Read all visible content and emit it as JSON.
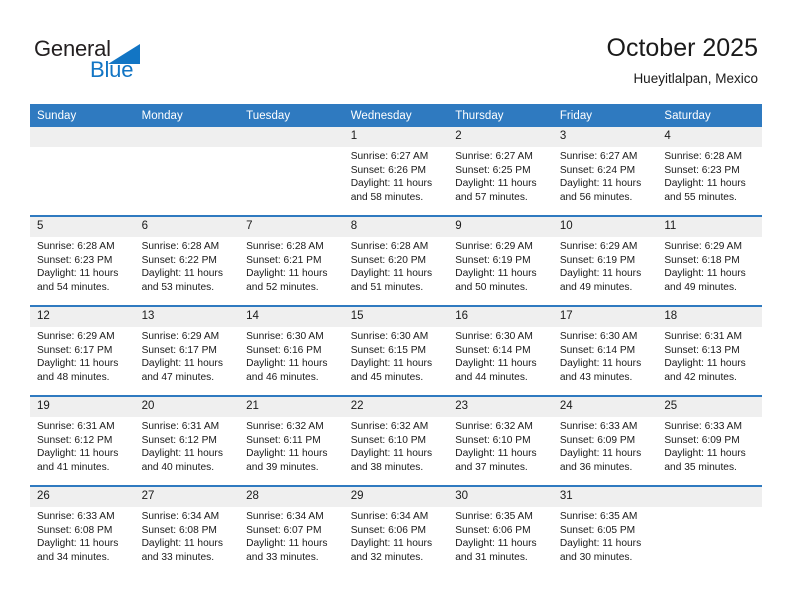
{
  "brand": {
    "name_part1": "General",
    "name_part2": "Blue",
    "accent_color": "#1275c4"
  },
  "header": {
    "title": "October 2025",
    "subtitle": "Hueyitlalpan, Mexico"
  },
  "calendar": {
    "header_color": "#2f7ac0",
    "daynum_band_color": "#efefef",
    "weekday_headers": [
      "Sunday",
      "Monday",
      "Tuesday",
      "Wednesday",
      "Thursday",
      "Friday",
      "Saturday"
    ],
    "weeks": [
      [
        {
          "day": "",
          "sunrise": "",
          "sunset": "",
          "daylight_line1": "",
          "daylight_line2": ""
        },
        {
          "day": "",
          "sunrise": "",
          "sunset": "",
          "daylight_line1": "",
          "daylight_line2": ""
        },
        {
          "day": "",
          "sunrise": "",
          "sunset": "",
          "daylight_line1": "",
          "daylight_line2": ""
        },
        {
          "day": "1",
          "sunrise": "Sunrise: 6:27 AM",
          "sunset": "Sunset: 6:26 PM",
          "daylight_line1": "Daylight: 11 hours",
          "daylight_line2": "and 58 minutes."
        },
        {
          "day": "2",
          "sunrise": "Sunrise: 6:27 AM",
          "sunset": "Sunset: 6:25 PM",
          "daylight_line1": "Daylight: 11 hours",
          "daylight_line2": "and 57 minutes."
        },
        {
          "day": "3",
          "sunrise": "Sunrise: 6:27 AM",
          "sunset": "Sunset: 6:24 PM",
          "daylight_line1": "Daylight: 11 hours",
          "daylight_line2": "and 56 minutes."
        },
        {
          "day": "4",
          "sunrise": "Sunrise: 6:28 AM",
          "sunset": "Sunset: 6:23 PM",
          "daylight_line1": "Daylight: 11 hours",
          "daylight_line2": "and 55 minutes."
        }
      ],
      [
        {
          "day": "5",
          "sunrise": "Sunrise: 6:28 AM",
          "sunset": "Sunset: 6:23 PM",
          "daylight_line1": "Daylight: 11 hours",
          "daylight_line2": "and 54 minutes."
        },
        {
          "day": "6",
          "sunrise": "Sunrise: 6:28 AM",
          "sunset": "Sunset: 6:22 PM",
          "daylight_line1": "Daylight: 11 hours",
          "daylight_line2": "and 53 minutes."
        },
        {
          "day": "7",
          "sunrise": "Sunrise: 6:28 AM",
          "sunset": "Sunset: 6:21 PM",
          "daylight_line1": "Daylight: 11 hours",
          "daylight_line2": "and 52 minutes."
        },
        {
          "day": "8",
          "sunrise": "Sunrise: 6:28 AM",
          "sunset": "Sunset: 6:20 PM",
          "daylight_line1": "Daylight: 11 hours",
          "daylight_line2": "and 51 minutes."
        },
        {
          "day": "9",
          "sunrise": "Sunrise: 6:29 AM",
          "sunset": "Sunset: 6:19 PM",
          "daylight_line1": "Daylight: 11 hours",
          "daylight_line2": "and 50 minutes."
        },
        {
          "day": "10",
          "sunrise": "Sunrise: 6:29 AM",
          "sunset": "Sunset: 6:19 PM",
          "daylight_line1": "Daylight: 11 hours",
          "daylight_line2": "and 49 minutes."
        },
        {
          "day": "11",
          "sunrise": "Sunrise: 6:29 AM",
          "sunset": "Sunset: 6:18 PM",
          "daylight_line1": "Daylight: 11 hours",
          "daylight_line2": "and 49 minutes."
        }
      ],
      [
        {
          "day": "12",
          "sunrise": "Sunrise: 6:29 AM",
          "sunset": "Sunset: 6:17 PM",
          "daylight_line1": "Daylight: 11 hours",
          "daylight_line2": "and 48 minutes."
        },
        {
          "day": "13",
          "sunrise": "Sunrise: 6:29 AM",
          "sunset": "Sunset: 6:17 PM",
          "daylight_line1": "Daylight: 11 hours",
          "daylight_line2": "and 47 minutes."
        },
        {
          "day": "14",
          "sunrise": "Sunrise: 6:30 AM",
          "sunset": "Sunset: 6:16 PM",
          "daylight_line1": "Daylight: 11 hours",
          "daylight_line2": "and 46 minutes."
        },
        {
          "day": "15",
          "sunrise": "Sunrise: 6:30 AM",
          "sunset": "Sunset: 6:15 PM",
          "daylight_line1": "Daylight: 11 hours",
          "daylight_line2": "and 45 minutes."
        },
        {
          "day": "16",
          "sunrise": "Sunrise: 6:30 AM",
          "sunset": "Sunset: 6:14 PM",
          "daylight_line1": "Daylight: 11 hours",
          "daylight_line2": "and 44 minutes."
        },
        {
          "day": "17",
          "sunrise": "Sunrise: 6:30 AM",
          "sunset": "Sunset: 6:14 PM",
          "daylight_line1": "Daylight: 11 hours",
          "daylight_line2": "and 43 minutes."
        },
        {
          "day": "18",
          "sunrise": "Sunrise: 6:31 AM",
          "sunset": "Sunset: 6:13 PM",
          "daylight_line1": "Daylight: 11 hours",
          "daylight_line2": "and 42 minutes."
        }
      ],
      [
        {
          "day": "19",
          "sunrise": "Sunrise: 6:31 AM",
          "sunset": "Sunset: 6:12 PM",
          "daylight_line1": "Daylight: 11 hours",
          "daylight_line2": "and 41 minutes."
        },
        {
          "day": "20",
          "sunrise": "Sunrise: 6:31 AM",
          "sunset": "Sunset: 6:12 PM",
          "daylight_line1": "Daylight: 11 hours",
          "daylight_line2": "and 40 minutes."
        },
        {
          "day": "21",
          "sunrise": "Sunrise: 6:32 AM",
          "sunset": "Sunset: 6:11 PM",
          "daylight_line1": "Daylight: 11 hours",
          "daylight_line2": "and 39 minutes."
        },
        {
          "day": "22",
          "sunrise": "Sunrise: 6:32 AM",
          "sunset": "Sunset: 6:10 PM",
          "daylight_line1": "Daylight: 11 hours",
          "daylight_line2": "and 38 minutes."
        },
        {
          "day": "23",
          "sunrise": "Sunrise: 6:32 AM",
          "sunset": "Sunset: 6:10 PM",
          "daylight_line1": "Daylight: 11 hours",
          "daylight_line2": "and 37 minutes."
        },
        {
          "day": "24",
          "sunrise": "Sunrise: 6:33 AM",
          "sunset": "Sunset: 6:09 PM",
          "daylight_line1": "Daylight: 11 hours",
          "daylight_line2": "and 36 minutes."
        },
        {
          "day": "25",
          "sunrise": "Sunrise: 6:33 AM",
          "sunset": "Sunset: 6:09 PM",
          "daylight_line1": "Daylight: 11 hours",
          "daylight_line2": "and 35 minutes."
        }
      ],
      [
        {
          "day": "26",
          "sunrise": "Sunrise: 6:33 AM",
          "sunset": "Sunset: 6:08 PM",
          "daylight_line1": "Daylight: 11 hours",
          "daylight_line2": "and 34 minutes."
        },
        {
          "day": "27",
          "sunrise": "Sunrise: 6:34 AM",
          "sunset": "Sunset: 6:08 PM",
          "daylight_line1": "Daylight: 11 hours",
          "daylight_line2": "and 33 minutes."
        },
        {
          "day": "28",
          "sunrise": "Sunrise: 6:34 AM",
          "sunset": "Sunset: 6:07 PM",
          "daylight_line1": "Daylight: 11 hours",
          "daylight_line2": "and 33 minutes."
        },
        {
          "day": "29",
          "sunrise": "Sunrise: 6:34 AM",
          "sunset": "Sunset: 6:06 PM",
          "daylight_line1": "Daylight: 11 hours",
          "daylight_line2": "and 32 minutes."
        },
        {
          "day": "30",
          "sunrise": "Sunrise: 6:35 AM",
          "sunset": "Sunset: 6:06 PM",
          "daylight_line1": "Daylight: 11 hours",
          "daylight_line2": "and 31 minutes."
        },
        {
          "day": "31",
          "sunrise": "Sunrise: 6:35 AM",
          "sunset": "Sunset: 6:05 PM",
          "daylight_line1": "Daylight: 11 hours",
          "daylight_line2": "and 30 minutes."
        },
        {
          "day": "",
          "sunrise": "",
          "sunset": "",
          "daylight_line1": "",
          "daylight_line2": ""
        }
      ]
    ]
  }
}
